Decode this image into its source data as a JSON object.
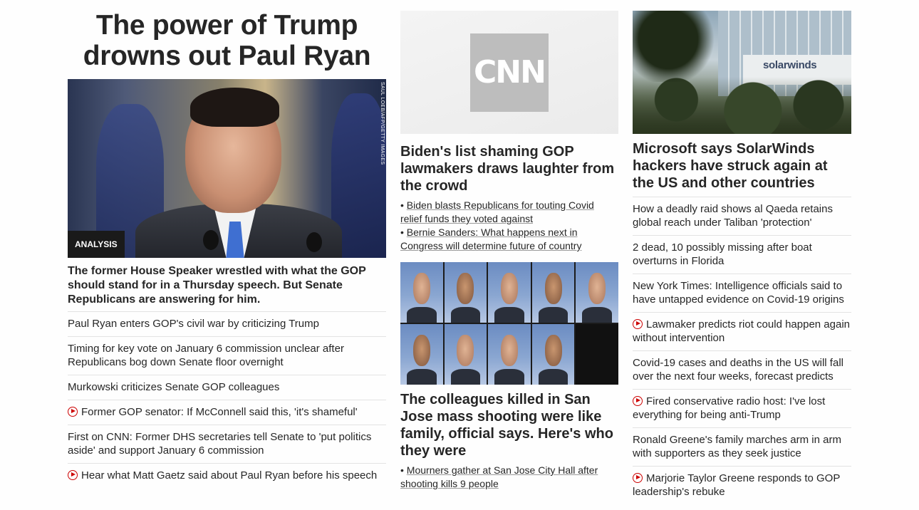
{
  "left": {
    "headline": "The power of Trump drowns out Paul Ryan",
    "image_credit": "SAUL LOEB/AFP/GETTY IMAGES",
    "badge": "ANALYSIS",
    "description": "The former House Speaker wrestled with what the GOP should stand for in a Thursday speech. But Senate Republicans are answering for him.",
    "links": [
      {
        "text": "Paul Ryan enters GOP's civil war by criticizing Trump",
        "video": false
      },
      {
        "text": "Timing for key vote on January 6 commission unclear after Republicans bog down Senate floor overnight",
        "video": false
      },
      {
        "text": "Murkowski criticizes Senate GOP colleagues",
        "video": false
      },
      {
        "text": "Former GOP senator: If McConnell said this, 'it's shameful'",
        "video": true
      },
      {
        "text": "First on CNN: Former DHS secretaries tell Senate to 'put politics aside' and support January 6 commission",
        "video": false
      },
      {
        "text": "Hear what Matt Gaetz said about Paul Ryan before his speech",
        "video": true
      }
    ]
  },
  "middle": {
    "logo_text": "CNN",
    "story1": {
      "headline": "Biden's list shaming GOP lawmakers draws laughter from the crowd",
      "links": [
        "Biden blasts Republicans for touting Covid relief funds they voted against",
        "Bernie Sanders: What happens next in Congress will determine future of country"
      ]
    },
    "story2": {
      "headline": "The colleagues killed in San Jose mass shooting were like family, official says. Here's who they were",
      "links": [
        "Mourners gather at San Jose City Hall after shooting kills 9 people"
      ]
    }
  },
  "right": {
    "image_brand": "solarwinds",
    "headline": "Microsoft says SolarWinds hackers have struck again at the US and other countries",
    "links": [
      {
        "text": "How a deadly raid shows al Qaeda retains global reach under Taliban 'protection'",
        "video": false
      },
      {
        "text": "2 dead, 10 possibly missing after boat overturns in Florida",
        "video": false
      },
      {
        "text": "New York Times: Intelligence officials said to have untapped evidence on Covid-19 origins",
        "video": false
      },
      {
        "text": "Lawmaker predicts riot could happen again without intervention",
        "video": true
      },
      {
        "text": "Covid-19 cases and deaths in the US will fall over the next four weeks, forecast predicts",
        "video": false
      },
      {
        "text": "Fired conservative radio host: I've lost everything for being anti-Trump",
        "video": true
      },
      {
        "text": "Ronald Greene's family marches arm in arm with supporters as they seek justice",
        "video": false
      },
      {
        "text": "Marjorie Taylor Greene responds to GOP leadership's rebuke",
        "video": true
      }
    ]
  },
  "colors": {
    "text": "#262626",
    "video_icon": "#cc0000",
    "badge_bg": "#1a1a1a",
    "divider": "#e3e3e3"
  }
}
